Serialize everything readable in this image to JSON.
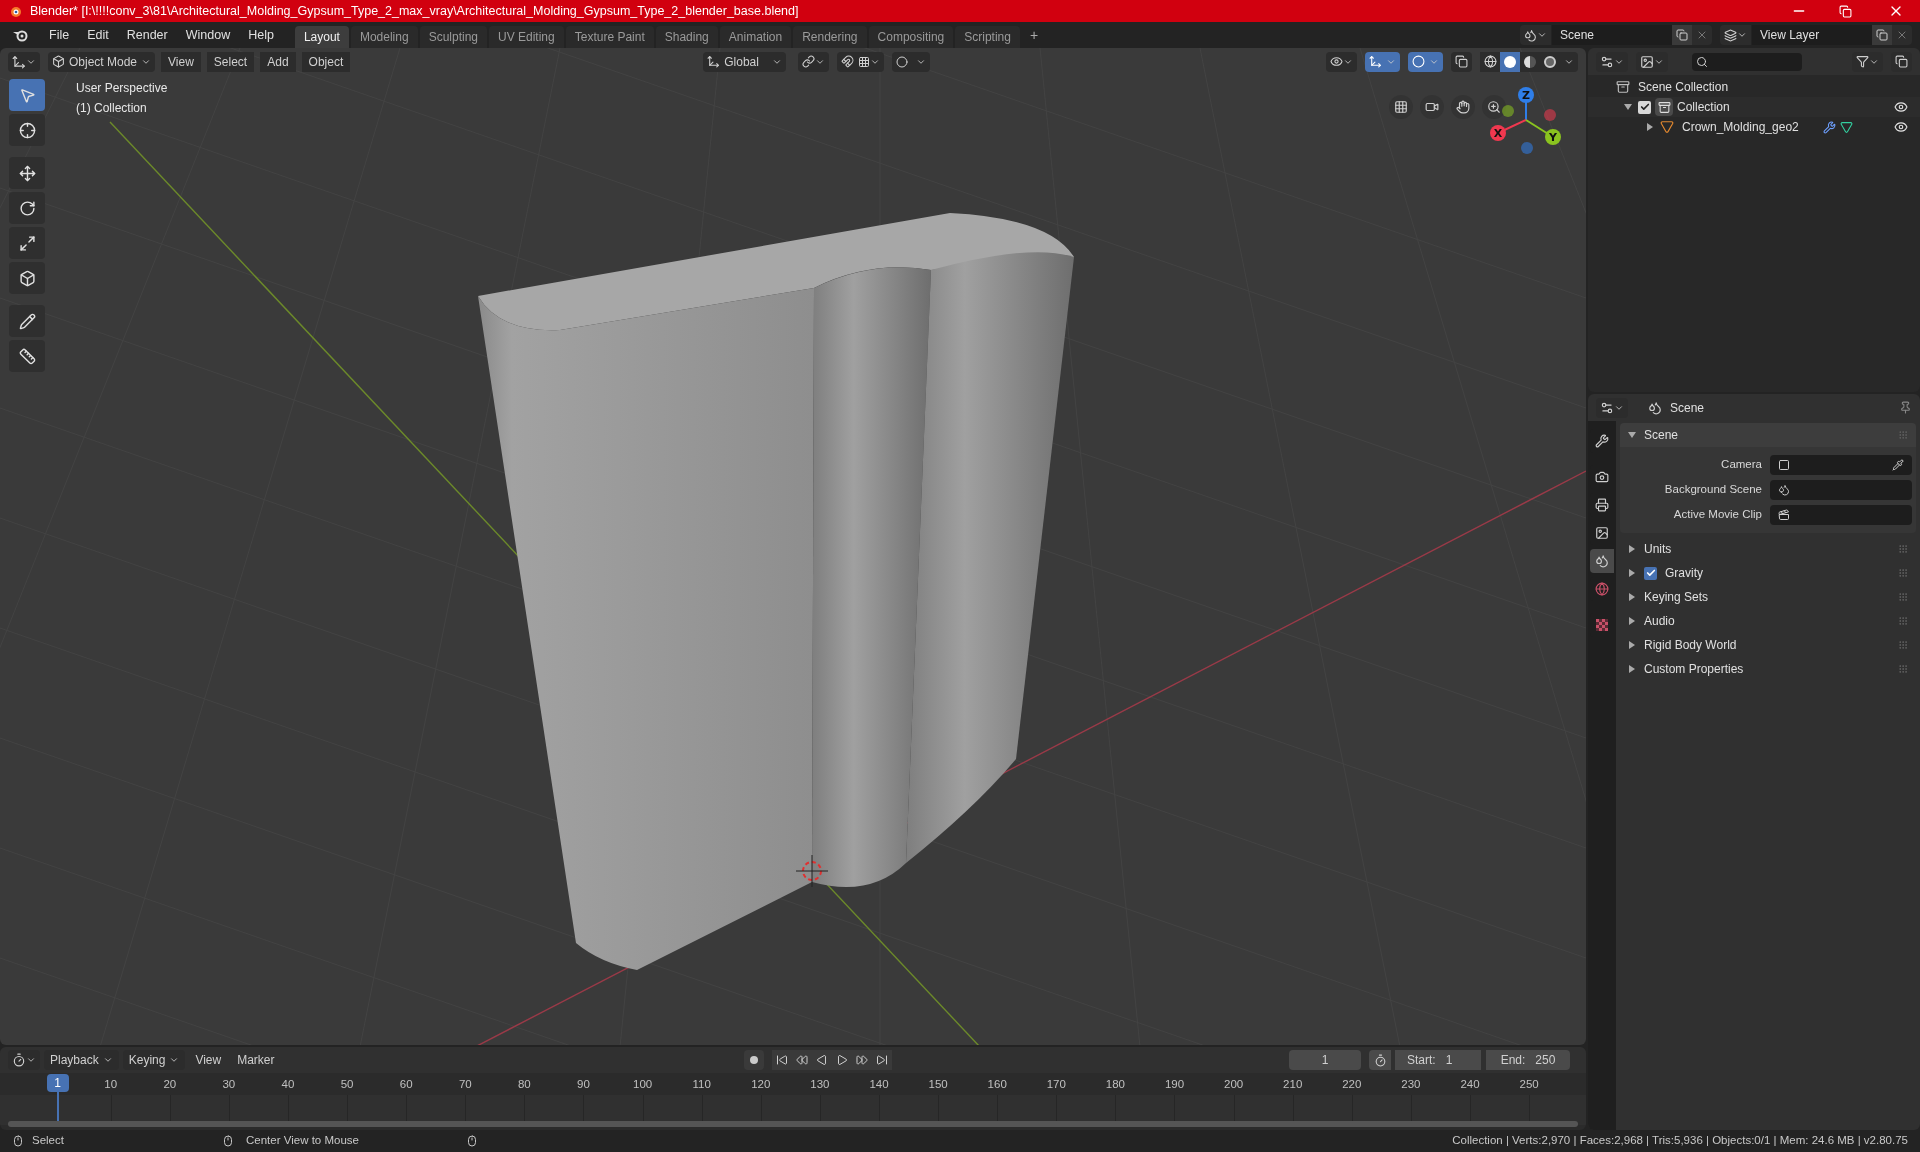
{
  "title_bar": {
    "title": "Blender* [I:\\!!!!conv_3\\81\\Architectural_Molding_Gypsum_Type_2_max_vray\\Architectural_Molding_Gypsum_Type_2_blender_base.blend]"
  },
  "menu": [
    "File",
    "Edit",
    "Render",
    "Window",
    "Help"
  ],
  "workspaces": [
    {
      "label": "Layout",
      "selected": true
    },
    {
      "label": "Modeling",
      "selected": false
    },
    {
      "label": "Sculpting",
      "selected": false
    },
    {
      "label": "UV Editing",
      "selected": false
    },
    {
      "label": "Texture Paint",
      "selected": false
    },
    {
      "label": "Shading",
      "selected": false
    },
    {
      "label": "Animation",
      "selected": false
    },
    {
      "label": "Rendering",
      "selected": false
    },
    {
      "label": "Compositing",
      "selected": false
    },
    {
      "label": "Scripting",
      "selected": false
    }
  ],
  "add_workspace": "+",
  "scene_selector": {
    "value": "Scene"
  },
  "view_layer_selector": {
    "value": "View Layer"
  },
  "viewport": {
    "mode": "Object Mode",
    "menus": [
      "View",
      "Select",
      "Add",
      "Object"
    ],
    "orientation": "Global",
    "overlay_text": [
      "User Perspective",
      "(1) Collection"
    ],
    "tools": [
      {
        "kind": "select",
        "selected": true
      },
      {
        "kind": "cursor",
        "selected": false
      },
      {
        "kind": "move",
        "selected": false
      },
      {
        "kind": "rotate",
        "selected": false
      },
      {
        "kind": "scale",
        "selected": false
      },
      {
        "kind": "transform",
        "selected": false
      },
      {
        "kind": "annotate",
        "selected": false
      },
      {
        "kind": "measure",
        "selected": false
      }
    ],
    "shading": [
      {
        "kind": "wireframe",
        "selected": false
      },
      {
        "kind": "solid",
        "selected": true
      },
      {
        "kind": "material",
        "selected": false
      },
      {
        "kind": "rendered",
        "selected": false
      }
    ],
    "axes": [
      {
        "label": "Z",
        "color": "#2f7ee8"
      },
      {
        "label": "X",
        "color": "#f0384f"
      },
      {
        "label": "Y",
        "color": "#8ac31f"
      }
    ]
  },
  "outliner": {
    "items": [
      {
        "label": "Scene Collection",
        "kind": "scene",
        "children": [
          {
            "label": "Collection",
            "kind": "collection",
            "checked": true,
            "expanded": true,
            "visible": true,
            "children": [
              {
                "label": "Crown_Molding_geo2",
                "kind": "mesh",
                "expanded": false,
                "visible": true
              }
            ]
          }
        ]
      }
    ]
  },
  "properties": {
    "header": "Scene",
    "tabs": [
      {
        "kind": "tool",
        "selected": false
      },
      {
        "kind": "render",
        "selected": false
      },
      {
        "kind": "output",
        "selected": false
      },
      {
        "kind": "view_layer",
        "selected": false
      },
      {
        "kind": "scene",
        "selected": true
      },
      {
        "kind": "world",
        "selected": false
      },
      {
        "kind": "texture",
        "selected": false
      }
    ],
    "panels": [
      {
        "label": "Scene",
        "kind": "plain",
        "expanded": true,
        "fields": [
          {
            "label": "Camera",
            "kind": "camera"
          },
          {
            "label": "Background Scene",
            "kind": "scene"
          },
          {
            "label": "Active Movie Clip",
            "kind": "clip"
          }
        ]
      },
      {
        "label": "Units",
        "kind": "plain",
        "expanded": false
      },
      {
        "label": "Gravity",
        "kind": "checkbox",
        "checked": true,
        "expanded": false
      },
      {
        "label": "Keying Sets",
        "kind": "plain",
        "expanded": false
      },
      {
        "label": "Audio",
        "kind": "plain",
        "expanded": false
      },
      {
        "label": "Rigid Body World",
        "kind": "plain",
        "expanded": false
      },
      {
        "label": "Custom Properties",
        "kind": "plain",
        "expanded": false
      }
    ]
  },
  "timeline": {
    "menus": [
      "Playback",
      "Keying",
      "View",
      "Marker"
    ],
    "current_frame": "1",
    "start": {
      "label": "Start:",
      "value": "1"
    },
    "end": {
      "label": "End:",
      "value": "250"
    },
    "playhead": "1",
    "ticks": [
      "10",
      "20",
      "30",
      "40",
      "50",
      "60",
      "70",
      "80",
      "90",
      "100",
      "110",
      "120",
      "130",
      "140",
      "150",
      "160",
      "170",
      "180",
      "190",
      "200",
      "210",
      "220",
      "230",
      "240",
      "250"
    ]
  },
  "status_bar": {
    "hints": [
      {
        "label": "Select"
      },
      {
        "label": "Center View to Mouse"
      }
    ],
    "stats": "Collection | Verts:2,970 | Faces:2,968 | Tris:5,936 | Objects:0/1 | Mem: 24.6 MB | v2.80.75"
  }
}
